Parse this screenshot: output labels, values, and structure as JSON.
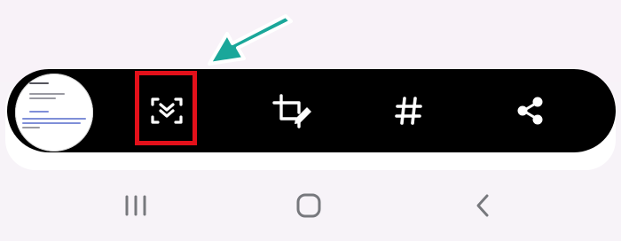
{
  "toolbar": {
    "thumbnail": {
      "name": "screenshot-thumbnail"
    },
    "tools": [
      {
        "id": "scroll-capture",
        "icon": "scroll-capture-icon",
        "highlighted": true
      },
      {
        "id": "crop-edit",
        "icon": "crop-edit-icon",
        "highlighted": false
      },
      {
        "id": "tag",
        "icon": "hashtag-icon",
        "highlighted": false
      },
      {
        "id": "share",
        "icon": "share-icon",
        "highlighted": false
      }
    ]
  },
  "annotations": {
    "highlight_color": "#e3101a",
    "arrow_color": "#1aa79a",
    "arrow_target": "scroll-capture"
  },
  "nav_bar": {
    "buttons": [
      {
        "id": "recent-apps",
        "icon": "recent-apps-icon"
      },
      {
        "id": "home",
        "icon": "home-icon"
      },
      {
        "id": "back",
        "icon": "back-icon"
      }
    ]
  },
  "colors": {
    "toolbar_bg": "#000000",
    "icon_color": "#ffffff",
    "nav_icon_color": "#77787d",
    "page_bg": "#f7f3f8"
  }
}
